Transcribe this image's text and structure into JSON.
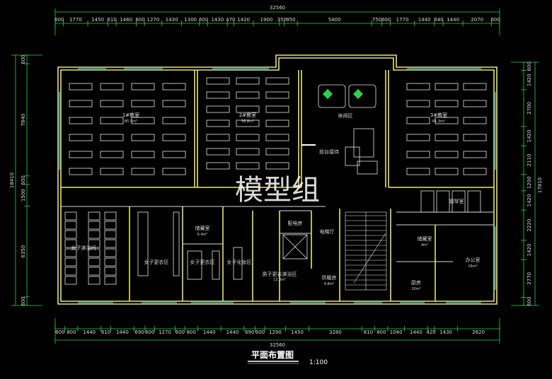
{
  "drawing": {
    "title": "平面布置图",
    "scale": "1:100",
    "watermark": "模型组",
    "colors": {
      "background": "#000000",
      "walls": "#e8e27a",
      "dimensions": "#2fd04a",
      "text": "#d9d9d9",
      "windows": "#2ab4c8"
    }
  },
  "dimensions": {
    "top_total": "32560",
    "bottom_total": "32560",
    "left_total": "18410",
    "right_total": "17810",
    "top_segments": [
      "600",
      "1770",
      "1450",
      "610",
      "1460",
      "600",
      "1270",
      "1430",
      "1300",
      "600",
      "1430",
      "470",
      "1420",
      "1900",
      "350",
      "950",
      "5400",
      "750",
      "600",
      "1770",
      "1440",
      "640",
      "1440",
      "2070",
      "600"
    ],
    "bottom_segments": [
      "600",
      "800",
      "1440",
      "610",
      "1440",
      "690",
      "600",
      "1270",
      "600",
      "800",
      "1440",
      "1440",
      "690",
      "600",
      "1290",
      "1450",
      "3280",
      "810",
      "800",
      "1040",
      "1440",
      "420",
      "1430",
      "2620"
    ],
    "left_segments": [
      "600",
      "7840",
      "600",
      "1500",
      "6350",
      "600"
    ],
    "right_segments": [
      "600",
      "1420",
      "2700",
      "1420",
      "2110",
      "1200",
      "1420",
      "2220",
      "1420",
      "2770",
      "600"
    ]
  },
  "rooms": [
    {
      "id": "classroom-1",
      "label": "1#教室",
      "area": "85.5m²"
    },
    {
      "id": "classroom-2",
      "label": "2#教室",
      "area": "56.8m²"
    },
    {
      "id": "classroom-3",
      "label": "3#教室",
      "area": "61.3m²"
    },
    {
      "id": "lounge",
      "label": "休闲区"
    },
    {
      "id": "front-desk",
      "label": "前台接待"
    },
    {
      "id": "female-shower",
      "label": "女子淋浴间"
    },
    {
      "id": "female-change-1",
      "label": "女子更衣区"
    },
    {
      "id": "female-change-2",
      "label": "女子更衣区"
    },
    {
      "id": "female-makeup",
      "label": "女子化妆区"
    },
    {
      "id": "storage",
      "label": "储藏室",
      "area": "6.4m²"
    },
    {
      "id": "power-room",
      "label": "配电房"
    },
    {
      "id": "elevator-hall",
      "label": "电梯厅"
    },
    {
      "id": "male-shower",
      "label": "男子更衣淋浴区",
      "area": "13.3m²"
    },
    {
      "id": "pump-room",
      "label": "供暖房",
      "area": "4.8m²"
    },
    {
      "id": "piano-room",
      "label": "钢琴室"
    },
    {
      "id": "storage-2",
      "label": "储藏室",
      "area": "4m²"
    },
    {
      "id": "office",
      "label": "办公室",
      "area": "16m²"
    },
    {
      "id": "kitchen",
      "label": "厨房",
      "area": "10m²"
    }
  ]
}
